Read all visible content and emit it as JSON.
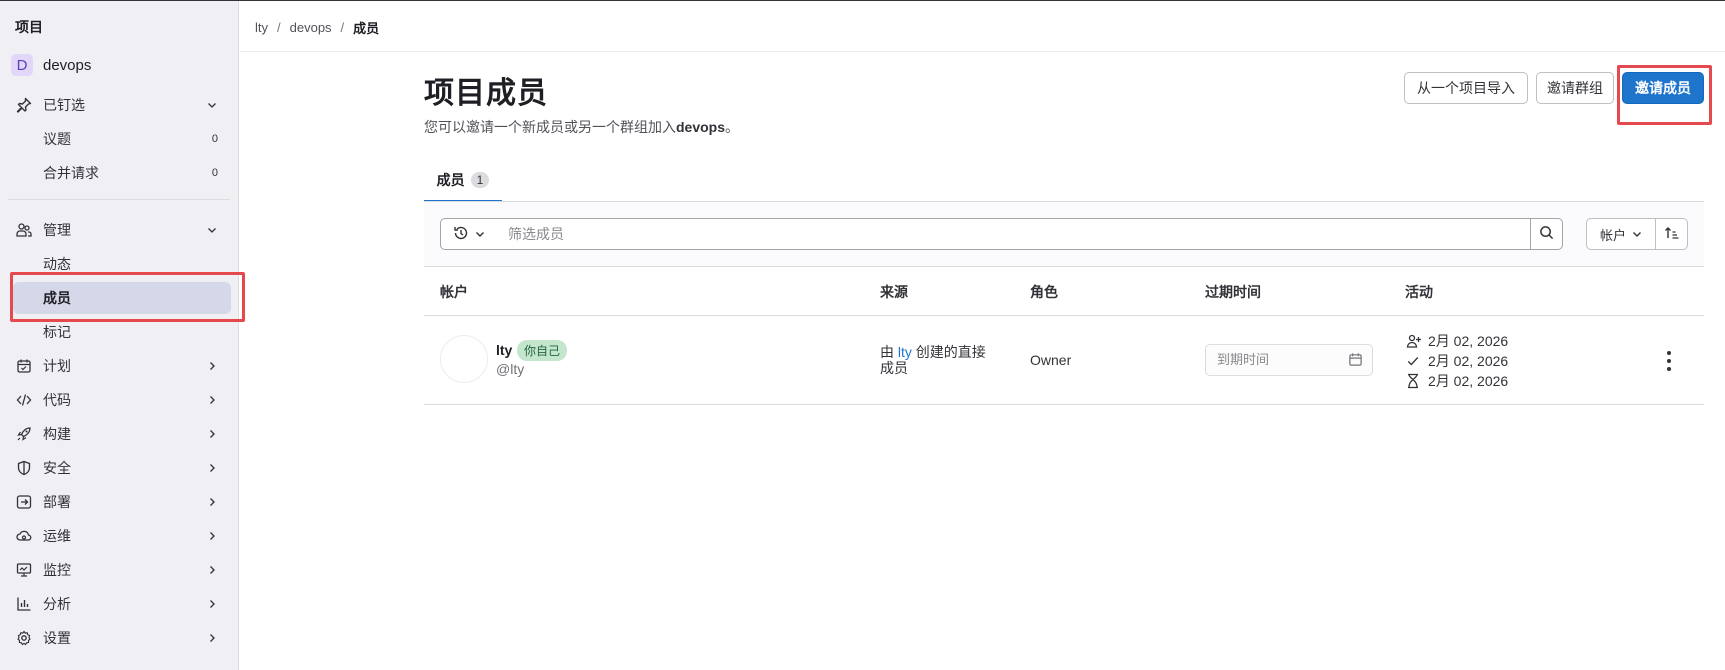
{
  "sidebar": {
    "section_title": "项目",
    "project": {
      "avatar_letter": "D",
      "name": "devops"
    },
    "pinned": {
      "label": "已钉选",
      "items": [
        {
          "label": "议题",
          "count": "0"
        },
        {
          "label": "合并请求",
          "count": "0"
        }
      ]
    },
    "manage": {
      "label": "管理",
      "items": [
        {
          "label": "动态"
        },
        {
          "label": "成员"
        },
        {
          "label": "标记"
        }
      ]
    },
    "nav": [
      {
        "label": "计划",
        "icon": "calendar-icon"
      },
      {
        "label": "代码",
        "icon": "code-icon"
      },
      {
        "label": "构建",
        "icon": "rocket-icon"
      },
      {
        "label": "安全",
        "icon": "shield-icon"
      },
      {
        "label": "部署",
        "icon": "deploy-icon"
      },
      {
        "label": "运维",
        "icon": "cloud-gear-icon"
      },
      {
        "label": "监控",
        "icon": "monitor-icon"
      },
      {
        "label": "分析",
        "icon": "chart-icon"
      },
      {
        "label": "设置",
        "icon": "gear-icon"
      }
    ]
  },
  "breadcrumb": {
    "items": [
      "lty",
      "devops",
      "成员"
    ],
    "separator": "/"
  },
  "header": {
    "title": "项目成员",
    "description_prefix": "您可以邀请一个新成员或另一个群组加入",
    "description_project": "devops",
    "description_suffix": "。",
    "import_button": "从一个项目导入",
    "invite_group_button": "邀请群组",
    "invite_member_button": "邀请成员"
  },
  "tabs": [
    {
      "label": "成员",
      "count": "1"
    }
  ],
  "filter": {
    "placeholder": "筛选成员",
    "sort_label": "帐户"
  },
  "table": {
    "headers": [
      "帐户",
      "来源",
      "角色",
      "过期时间",
      "活动"
    ],
    "rows": [
      {
        "name": "lty",
        "badge": "你自己",
        "handle": "@lty",
        "source_prefix": "由 ",
        "source_link": "lty",
        "source_suffix": " 创建的直接成员",
        "role": "Owner",
        "expire_placeholder": "到期时间",
        "activity": [
          "2月 02, 2026",
          "2月 02, 2026",
          "2月 02, 2026"
        ]
      }
    ]
  },
  "colors": {
    "primary": "#1f75cb",
    "highlight": "#e5484d",
    "sidebar_bg": "#f0eff4",
    "active_item": "#d4d8e8"
  }
}
